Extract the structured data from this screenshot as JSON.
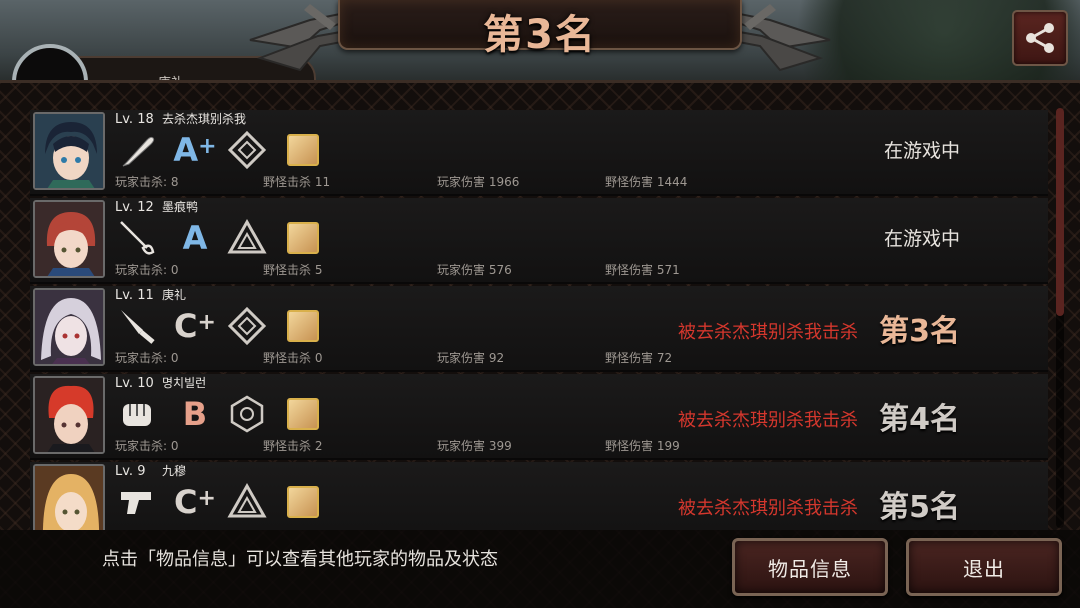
{
  "header": {
    "title": "第3名"
  },
  "mini_profile": {
    "name": "庚礼"
  },
  "players": [
    {
      "level": "Lv. 18",
      "name": "去杀杰琪别杀我",
      "grade": "A",
      "grade_plus": "+",
      "weapon_icon": "bat-icon",
      "emblem_icon": "diamond-emblem-icon",
      "stats": {
        "player_kills": "玩家击杀: 8",
        "monster_kills": "野怪击杀 11",
        "player_damage": "玩家伤害 1966",
        "monster_damage": "野怪伤害 1444"
      },
      "status": "在游戏中",
      "killed_by": "",
      "rank": ""
    },
    {
      "level": "Lv. 12",
      "name": "墨痕鸭",
      "grade": "A",
      "grade_plus": "",
      "weapon_icon": "rapier-icon",
      "emblem_icon": "triangle-emblem-icon",
      "stats": {
        "player_kills": "玩家击杀: 0",
        "monster_kills": "野怪击杀 5",
        "player_damage": "玩家伤害 576",
        "monster_damage": "野怪伤害 571"
      },
      "status": "在游戏中",
      "killed_by": "",
      "rank": ""
    },
    {
      "level": "Lv. 11",
      "name": "庚礼",
      "grade": "C",
      "grade_plus": "+",
      "weapon_icon": "knife-icon",
      "emblem_icon": "diamond-emblem-icon",
      "stats": {
        "player_kills": "玩家击杀: 0",
        "monster_kills": "野怪击杀 0",
        "player_damage": "玩家伤害 92",
        "monster_damage": "野怪伤害 72"
      },
      "status": "",
      "killed_by": "被去杀杰琪别杀我击杀",
      "rank": "第3名"
    },
    {
      "level": "Lv. 10",
      "name": "명치빌런",
      "grade": "B",
      "grade_plus": "",
      "weapon_icon": "glove-icon",
      "emblem_icon": "hexagon-emblem-icon",
      "stats": {
        "player_kills": "玩家击杀: 0",
        "monster_kills": "野怪击杀 2",
        "player_damage": "玩家伤害 399",
        "monster_damage": "野怪伤害 199"
      },
      "status": "",
      "killed_by": "被去杀杰琪别杀我击杀",
      "rank": "第4名"
    },
    {
      "level": "Lv. 9",
      "name": "九穆",
      "grade": "C",
      "grade_plus": "+",
      "weapon_icon": "pistol-icon",
      "emblem_icon": "triangle-emblem-icon",
      "stats": {
        "player_kills": "",
        "monster_kills": "",
        "player_damage": "",
        "monster_damage": ""
      },
      "status": "",
      "killed_by": "被去杀杰琪别杀我击杀",
      "rank": "第5名"
    }
  ],
  "footer": {
    "hint": "点击「物品信息」可以查看其他玩家的物品及状态",
    "items_button": "物品信息",
    "exit_button": "退出"
  },
  "colors": {
    "title": "#e9b797",
    "killed_text": "#d4372d",
    "grade_a": "#7fb7e6",
    "grade_b": "#e6a08a",
    "grade_c": "#d8d2cc"
  }
}
